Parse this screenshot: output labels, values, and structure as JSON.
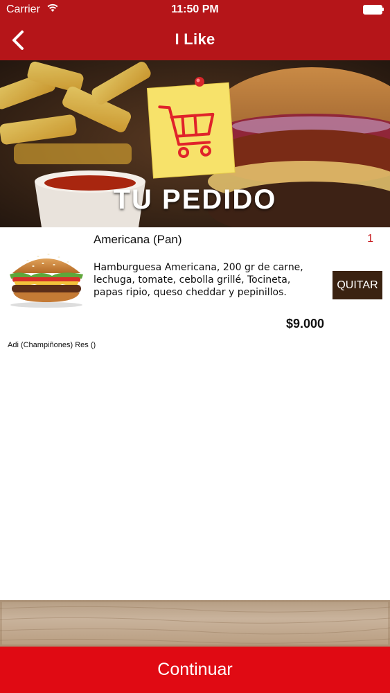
{
  "status_bar": {
    "carrier": "Carrier",
    "time": "11:50 PM"
  },
  "navbar": {
    "title": "I Like",
    "back_icon": "chevron-left-icon"
  },
  "banner": {
    "title": "TU PEDIDO",
    "icon": "shopping-cart-icon"
  },
  "order": {
    "items": [
      {
        "name": "Americana (Pan)",
        "quantity": "1",
        "description": "Hamburguesa Americana,  200 gr de carne, lechuga, tomate, cebolla grillé, Tocineta, papas ripio, queso cheddar y pepinillos.",
        "remove_label": "QUITAR",
        "price": "$9.000",
        "extras": "Adi (Champiñones) Res ()"
      }
    ]
  },
  "footer": {
    "continue_label": "Continuar"
  },
  "colors": {
    "header": "#b51519",
    "accent_red": "#e00a13",
    "remove_button": "#3a2211",
    "quantity": "#c61b1f"
  }
}
